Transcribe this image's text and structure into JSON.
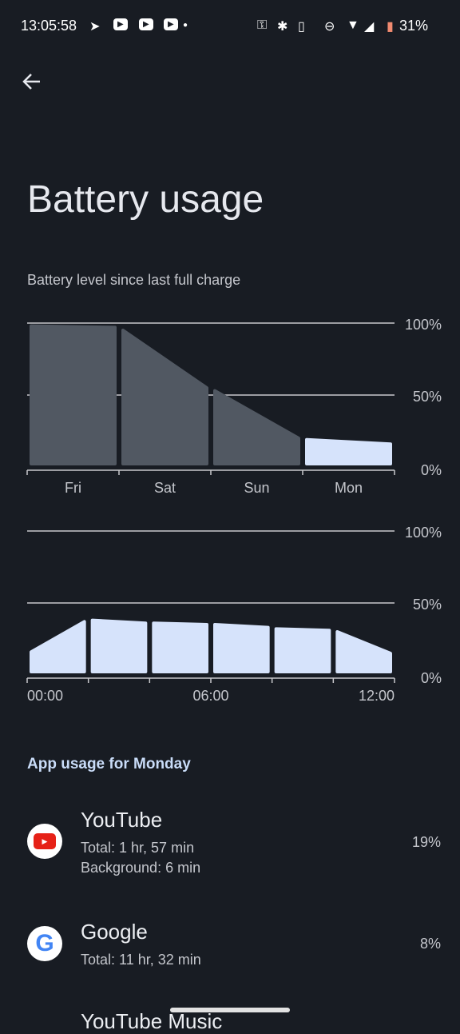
{
  "status_bar": {
    "time": "13:05:58",
    "battery": "31%",
    "icons": [
      "telegram-icon",
      "youtube-icon",
      "youtube-icon",
      "youtube-icon",
      "dot-icon",
      "vpn-key-icon",
      "bluetooth-icon",
      "vibrate-icon",
      "dnd-icon",
      "wifi-icon",
      "signal-icon",
      "battery-icon"
    ],
    "battery_color": "#f08a70"
  },
  "header": {
    "title": "Battery usage",
    "back_icon": "arrow-left-icon"
  },
  "subtitle": "Battery level since last full charge",
  "chart_data": [
    {
      "type": "area",
      "categories": [
        "Fri",
        "Sat",
        "Sun",
        "Mon"
      ],
      "y_ticks": [
        "100%",
        "50%",
        "0%"
      ],
      "ylim": [
        0,
        100
      ],
      "grid": true,
      "segments": [
        {
          "start": 98,
          "end": 97,
          "selected": false
        },
        {
          "start": 95,
          "end": 55,
          "selected": false
        },
        {
          "start": 53,
          "end": 20,
          "selected": false
        },
        {
          "start": 19,
          "end": 16,
          "selected": true
        }
      ],
      "colors": {
        "unselected": "#515862",
        "selected": "#d6e3fb"
      }
    },
    {
      "type": "area",
      "x_tick_labels": [
        "00:00",
        "06:00",
        "12:00"
      ],
      "y_ticks": [
        "100%",
        "50%",
        "0%"
      ],
      "ylim": [
        0,
        100
      ],
      "grid": true,
      "segments": [
        {
          "start": 16,
          "end": 37
        },
        {
          "start": 38,
          "end": 36
        },
        {
          "start": 36,
          "end": 35
        },
        {
          "start": 35,
          "end": 33
        },
        {
          "start": 32,
          "end": 31
        },
        {
          "start": 30,
          "end": 15
        }
      ],
      "colors": {
        "bar": "#d6e3fb"
      }
    }
  ],
  "section_title": "App usage for Monday",
  "apps": [
    {
      "name": "YouTube",
      "lines": [
        "Total: 1 hr, 57 min",
        "Background: 6 min"
      ],
      "percent": "19%",
      "icon": "youtube-icon"
    },
    {
      "name": "Google",
      "lines": [
        "Total: 11 hr, 32 min"
      ],
      "percent": "8%",
      "icon": "google-icon"
    },
    {
      "name": "YouTube Music",
      "lines": [],
      "percent": "",
      "icon": "youtube-music-icon"
    }
  ]
}
